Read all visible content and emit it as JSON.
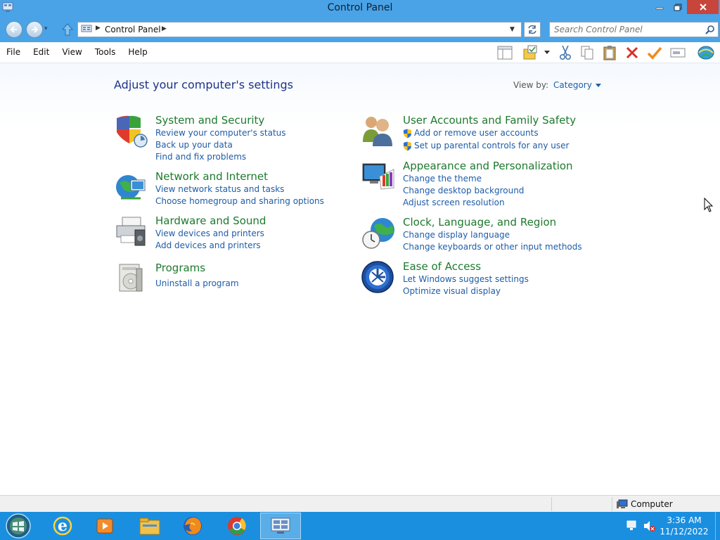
{
  "window": {
    "title": "Control Panel"
  },
  "address": {
    "crumb": "Control Panel",
    "search_placeholder": "Search Control Panel"
  },
  "menu": {
    "file": "File",
    "edit": "Edit",
    "view": "View",
    "tools": "Tools",
    "help": "Help"
  },
  "main": {
    "heading": "Adjust your computer's settings",
    "view_by_label": "View by:",
    "view_by_value": "Category",
    "categories": [
      {
        "title": "System and Security",
        "icon": "shield-icon",
        "links": [
          "Review your computer's status",
          "Back up your data",
          "Find and fix problems"
        ]
      },
      {
        "title": "Network and Internet",
        "icon": "network-globe-icon",
        "links": [
          "View network status and tasks",
          "Choose homegroup and sharing options"
        ]
      },
      {
        "title": "Hardware and Sound",
        "icon": "printer-speaker-icon",
        "links": [
          "View devices and printers",
          "Add devices and printers"
        ]
      },
      {
        "title": "Programs",
        "icon": "programs-disc-icon",
        "links": [
          "Uninstall a program"
        ]
      },
      {
        "title": "User Accounts and Family Safety",
        "icon": "users-icon",
        "links": [
          "Add or remove user accounts",
          "Set up parental controls for any user"
        ]
      },
      {
        "title": "Appearance and Personalization",
        "icon": "monitor-palette-icon",
        "links": [
          "Change the theme",
          "Change desktop background",
          "Adjust screen resolution"
        ]
      },
      {
        "title": "Clock, Language, and Region",
        "icon": "clock-globe-icon",
        "links": [
          "Change display language",
          "Change keyboards or other input methods"
        ]
      },
      {
        "title": "Ease of Access",
        "icon": "ease-of-access-icon",
        "links": [
          "Let Windows suggest settings",
          "Optimize visual display"
        ]
      }
    ]
  },
  "statusbar": {
    "location": "Computer"
  },
  "taskbar": {
    "apps": [
      "internet-explorer-icon",
      "media-player-icon",
      "file-explorer-icon",
      "firefox-icon",
      "chrome-icon",
      "control-panel-icon"
    ],
    "time": "3:36 AM",
    "date": "11/12/2022"
  },
  "colors": {
    "titlebar": "#4aa3e6",
    "taskbar": "#1a8fe0",
    "category_title": "#1d7a2e",
    "link": "#1d5ca8",
    "heading": "#1e3287"
  }
}
